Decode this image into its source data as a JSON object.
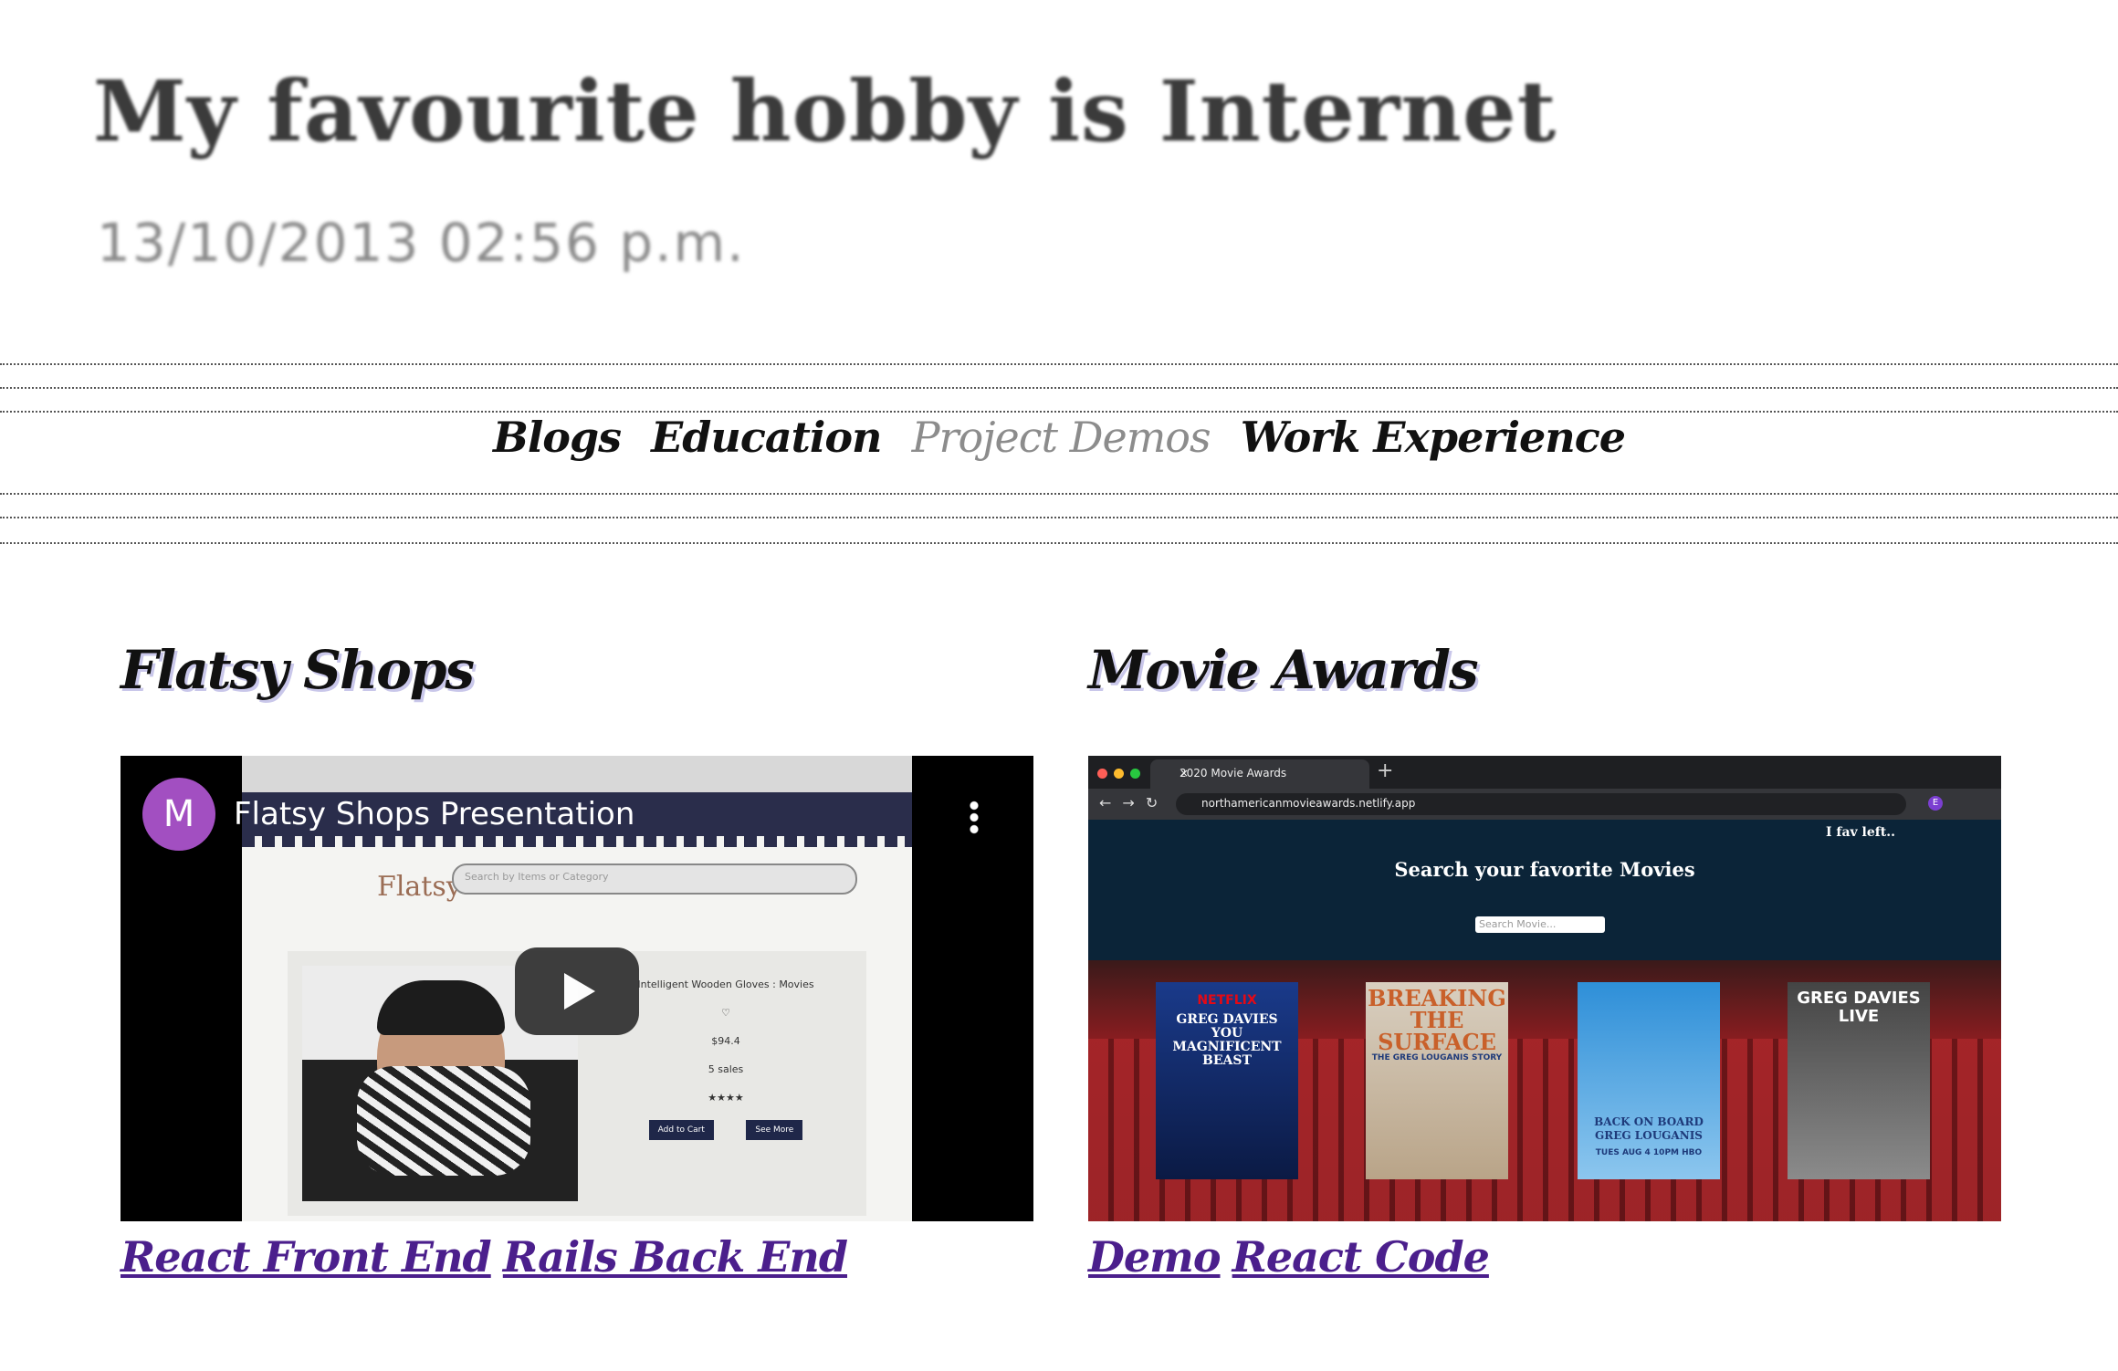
{
  "banner": {
    "title": "My favourite hobby is Internet",
    "date": "13/10/2013 02:56 p.m."
  },
  "nav": {
    "items": [
      {
        "label": "Blogs",
        "active": false
      },
      {
        "label": "Education",
        "active": false
      },
      {
        "label": "Project Demos",
        "active": true
      },
      {
        "label": "Work Experience",
        "active": false
      }
    ]
  },
  "projects": [
    {
      "title": "Flatsy Shops",
      "video": {
        "channel_initial": "M",
        "title": "Flatsy Shops Presentation",
        "site_logo": "Flatsy",
        "site_search_placeholder": "Search by Items or Category",
        "product_name": "Intelligent Wooden Gloves : Movies",
        "price": "$94.4",
        "sales": "5 sales",
        "rating": "★★★★",
        "add_to_cart": "Add to Cart",
        "see_more": "See More",
        "play_icon": "play-icon",
        "menu_icon": "kebab-menu-icon",
        "accent": "#a24fc1"
      },
      "links": [
        "React Front End",
        "Rails Back End"
      ]
    },
    {
      "title": "Movie Awards",
      "screenshot": {
        "tab_title": "2020 Movie Awards",
        "url": "northamericanmovieawards.netlify.app",
        "top_right": "I fav left..",
        "heading": "Search your favorite Movies",
        "search_placeholder": "Search Movie...",
        "posters": [
          {
            "brand": "NETFLIX",
            "text": "GREG DAVIES YOU MAGNIFICENT BEAST"
          },
          {
            "title": "BREAKING THE SURFACE",
            "sub": "THE GREG LOUGANIS STORY"
          },
          {
            "text": "BACK ON BOARD GREG LOUGANIS",
            "sub": "TUES AUG 4 10PM HBO"
          },
          {
            "title": "GREG DAVIES LIVE"
          }
        ]
      },
      "links": [
        "Demo",
        "React Code"
      ]
    }
  ],
  "colors": {
    "link": "#4b1f8c",
    "nav_active": "#8c8c8c",
    "title_shadow": "#c9c7ea"
  }
}
